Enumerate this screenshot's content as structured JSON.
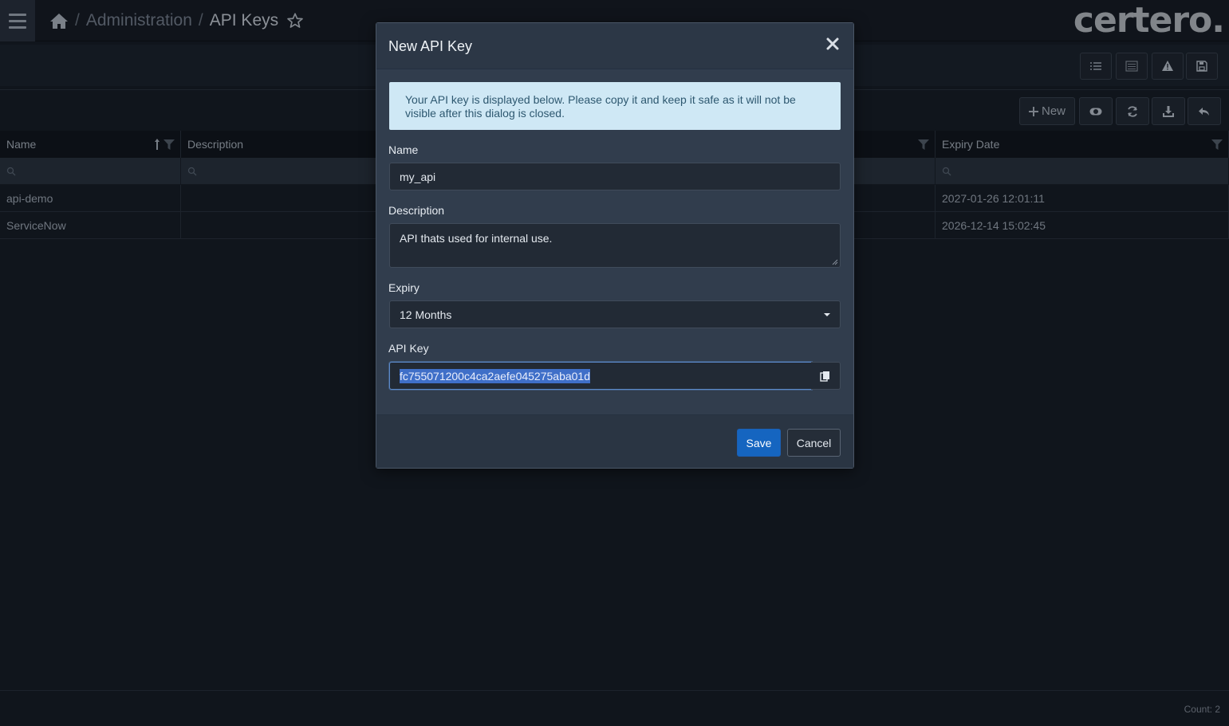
{
  "breadcrumb": {
    "section": "Administration",
    "page": "API Keys",
    "separator": "/"
  },
  "logo": "certero.",
  "grid": {
    "new_label": "New",
    "columns": [
      "Name",
      "Description",
      "Expiry Date"
    ],
    "rows": [
      {
        "name": "api-demo",
        "description": "",
        "expiry": "2027-01-26 12:01:11"
      },
      {
        "name": "ServiceNow",
        "description": "",
        "expiry": "2026-12-14 15:02:45"
      }
    ],
    "count": "Count: 2"
  },
  "modal": {
    "title": "New API Key",
    "info": "Your API key is displayed below. Please copy it and keep it safe as it will not be visible after this dialog is closed.",
    "name_label": "Name",
    "name_value": "my_api",
    "description_label": "Description",
    "description_value": "API thats used for internal use.",
    "expiry_label": "Expiry",
    "expiry_value": "12 Months",
    "key_label": "API Key",
    "key_value": "fc755071200c4ca2aefe045275aba01d",
    "save_label": "Save",
    "cancel_label": "Cancel"
  },
  "colors": {
    "primary": "#1565c0",
    "info_bg": "#cfe8f5",
    "selection": "#3f6fc8"
  }
}
